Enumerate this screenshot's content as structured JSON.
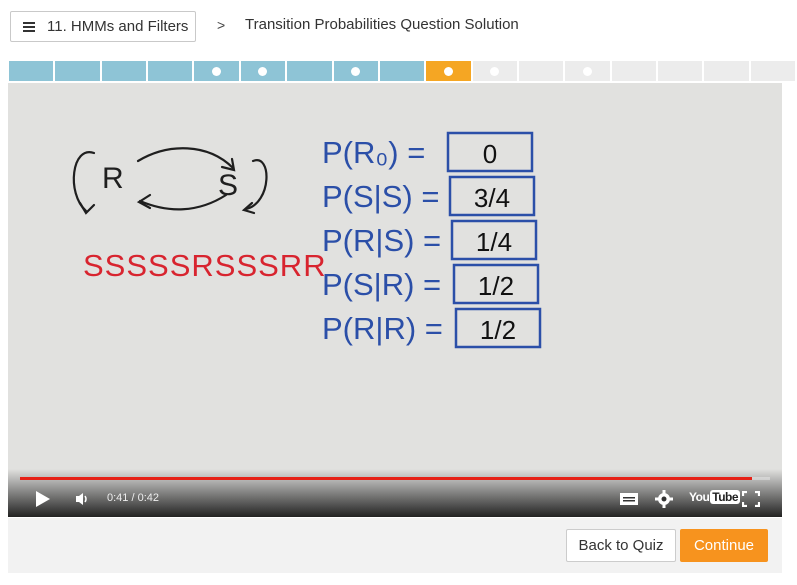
{
  "header": {
    "lesson_label": "11. HMMs and Filters",
    "separator": ">",
    "title": "Transition Probabilities Question Solution"
  },
  "progress": {
    "segments": [
      "done",
      "done",
      "done",
      "done",
      "done",
      "done",
      "done",
      "done",
      "done",
      "current",
      "todo",
      "todo",
      "todo",
      "todo",
      "todo",
      "todo",
      "todo"
    ],
    "dots": [
      4,
      5,
      7,
      9,
      10,
      12
    ],
    "colors": {
      "done": "#8ec4d6",
      "current": "#f5a623",
      "todo": "#ececec"
    }
  },
  "whiteboard": {
    "states": [
      "R",
      "S"
    ],
    "sequence": "SSSSSRSSSRR",
    "equations": [
      {
        "lhs": "P(R₀) =",
        "value": "0"
      },
      {
        "lhs": "P(S|S) =",
        "value": "3/4"
      },
      {
        "lhs": "P(R|S) =",
        "value": "1/4"
      },
      {
        "lhs": "P(S|R) =",
        "value": "1/2"
      },
      {
        "lhs": "P(R|R) =",
        "value": "1/2"
      }
    ]
  },
  "player": {
    "time_display": "0:41 / 0:42",
    "progress_fraction": 0.976,
    "youtube_label": "You",
    "youtube_label_box": "Tube"
  },
  "actions": {
    "back_label": "Back to Quiz",
    "continue_label": "Continue"
  }
}
